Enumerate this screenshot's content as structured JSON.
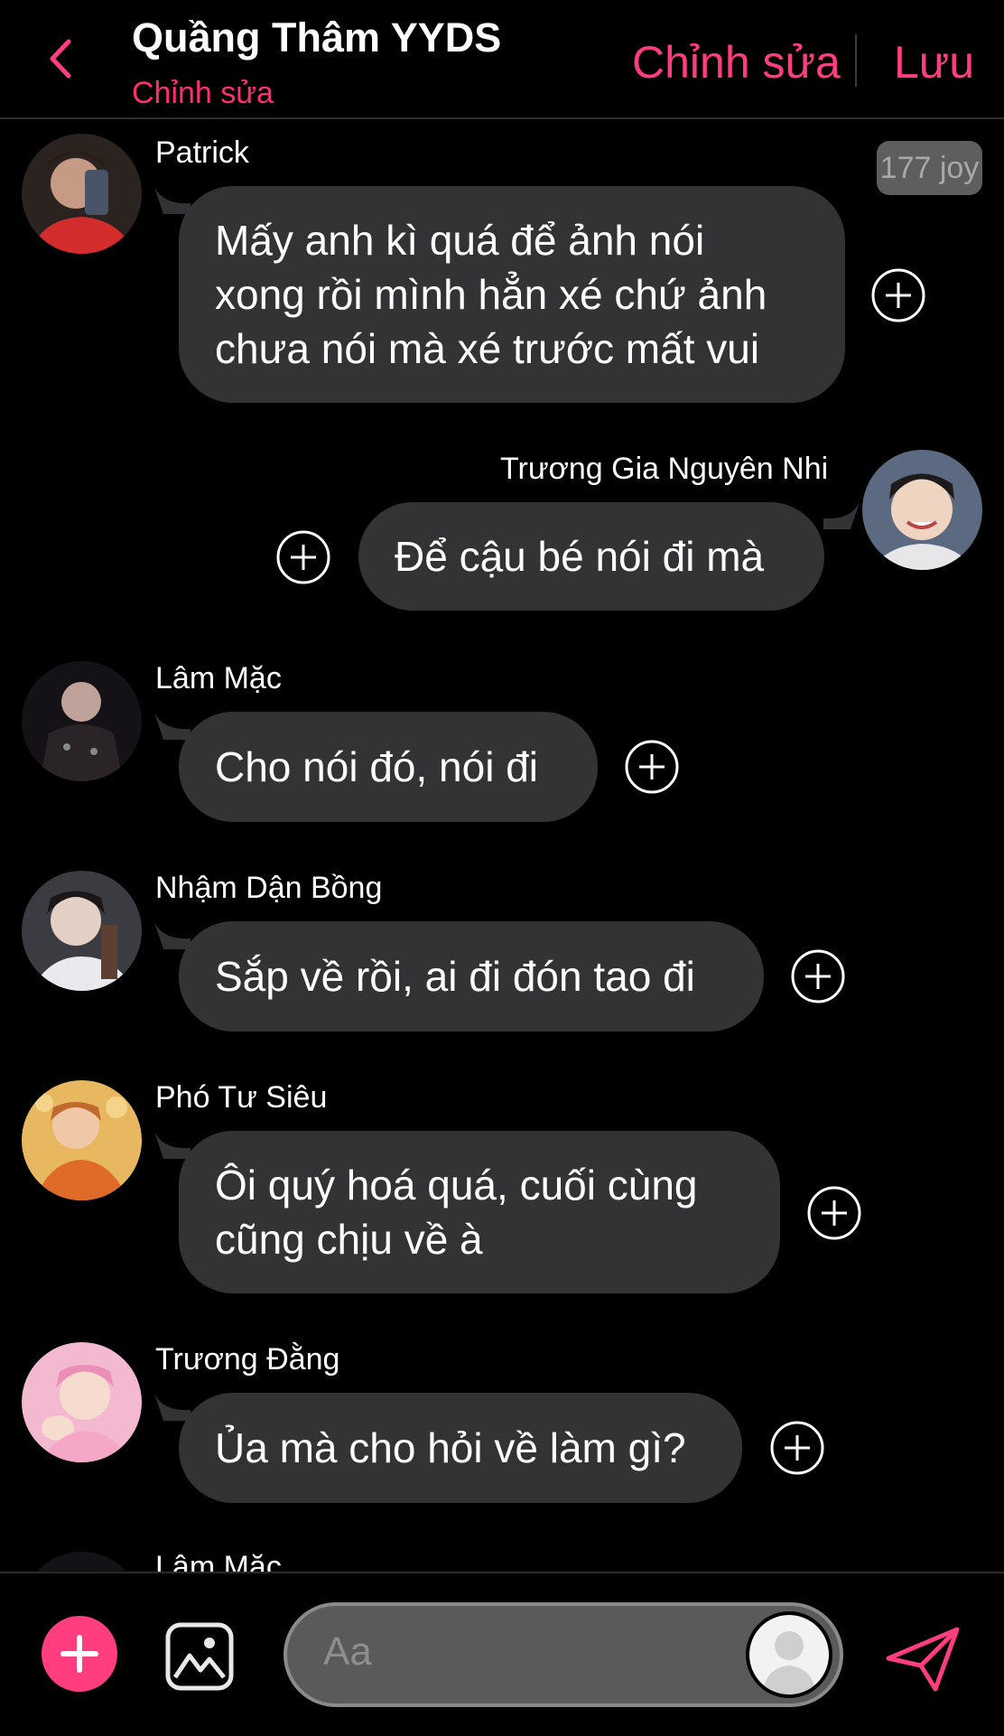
{
  "header": {
    "title": "Quầng Thâm YYDS",
    "subtitle": "Chỉnh sửa",
    "edit_label": "Chỉnh sửa",
    "save_label": "Lưu"
  },
  "messages": [
    {
      "sender": "Patrick",
      "lines": [
        "Mấy anh kì quá để ảnh nói",
        "xong rồi mình hẳn xé chứ ảnh",
        "chưa nói mà xé trước mất vui"
      ],
      "badge": "177 joy"
    },
    {
      "sender": "Trương Gia Nguyên Nhi",
      "lines": [
        "Để cậu bé nói đi mà"
      ]
    },
    {
      "sender": "Lâm Mặc",
      "lines": [
        "Cho nói đó, nói đi"
      ]
    },
    {
      "sender": "Nhậm Dận Bồng",
      "lines": [
        "Sắp về rồi, ai đi đón tao đi"
      ]
    },
    {
      "sender": "Phó Tư Siêu",
      "lines": [
        "Ôi quý hoá quá, cuối cùng",
        "cũng chịu về à"
      ]
    },
    {
      "sender": "Trương Đằng",
      "lines": [
        "Ủa mà cho hỏi về làm gì?"
      ]
    },
    {
      "sender": "Lâm Mặc"
    }
  ],
  "composer": {
    "placeholder": "Aa"
  },
  "colors": {
    "accent": "#ff3d7f",
    "bubble": "#333335",
    "background": "#000000"
  },
  "icons": [
    "chevron-left-icon",
    "plus-circle-icon",
    "image-icon",
    "send-icon",
    "person-icon"
  ]
}
